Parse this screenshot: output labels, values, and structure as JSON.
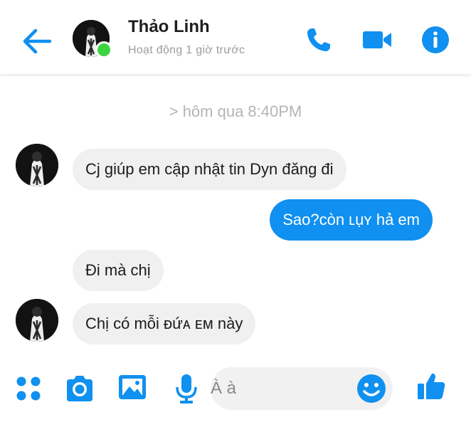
{
  "header": {
    "contact_name": "Thảo Linh",
    "status": "Hoạt động 1 giờ trước",
    "accent_color": "#1090f0",
    "online_color": "#3cd542",
    "icons": [
      "back-arrow-icon",
      "phone-icon",
      "video-camera-icon",
      "info-icon"
    ]
  },
  "conversation": {
    "timestamp": "> hôm qua 8:40PM",
    "messages": [
      {
        "direction": "in",
        "text": "Cj giúp em cập nhật tin Dyn đăng đi",
        "show_avatar": true
      },
      {
        "direction": "out",
        "text": "Sao?còn ʟụʏ hả em"
      },
      {
        "direction": "in",
        "text": "Đi mà chị",
        "show_avatar": false
      },
      {
        "direction": "in",
        "text": "Chị có mỗi ᴆứᴀ ᴇᴍ này",
        "show_avatar": true
      }
    ]
  },
  "composer": {
    "placeholder": "À à",
    "icons": [
      "menu-dots-icon",
      "camera-icon",
      "image-icon",
      "microphone-icon",
      "emoji-icon",
      "thumbs-up-icon"
    ]
  }
}
